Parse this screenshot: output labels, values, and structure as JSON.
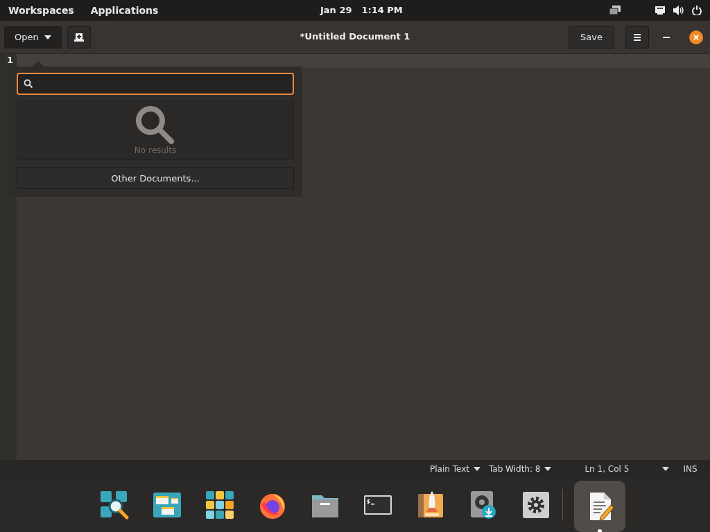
{
  "top_panel": {
    "menus": [
      "Workspaces",
      "Applications"
    ],
    "date": "Jan 29",
    "time": "1:14 PM"
  },
  "header": {
    "open_label": "Open",
    "title": "*Untitled Document 1",
    "save_label": "Save"
  },
  "editor": {
    "line_numbers": [
      "1"
    ]
  },
  "open_popover": {
    "empty_text": "No results",
    "other_button": "Other Documents..."
  },
  "status_bar": {
    "language": "Plain Text",
    "tab_width": "Tab Width: 8",
    "position": "Ln 1, Col 5",
    "mode": "INS"
  },
  "dock": [
    {
      "kind": "search",
      "running": false
    },
    {
      "kind": "multitask",
      "running": false
    },
    {
      "kind": "grid",
      "running": false
    },
    {
      "kind": "browser",
      "running": false
    },
    {
      "kind": "folder",
      "running": false
    },
    {
      "kind": "terminal",
      "running": false
    },
    {
      "kind": "rocket",
      "running": false
    },
    {
      "kind": "installer",
      "running": false
    },
    {
      "kind": "settings",
      "running": false
    },
    {
      "kind": "editor",
      "running": true
    }
  ]
}
